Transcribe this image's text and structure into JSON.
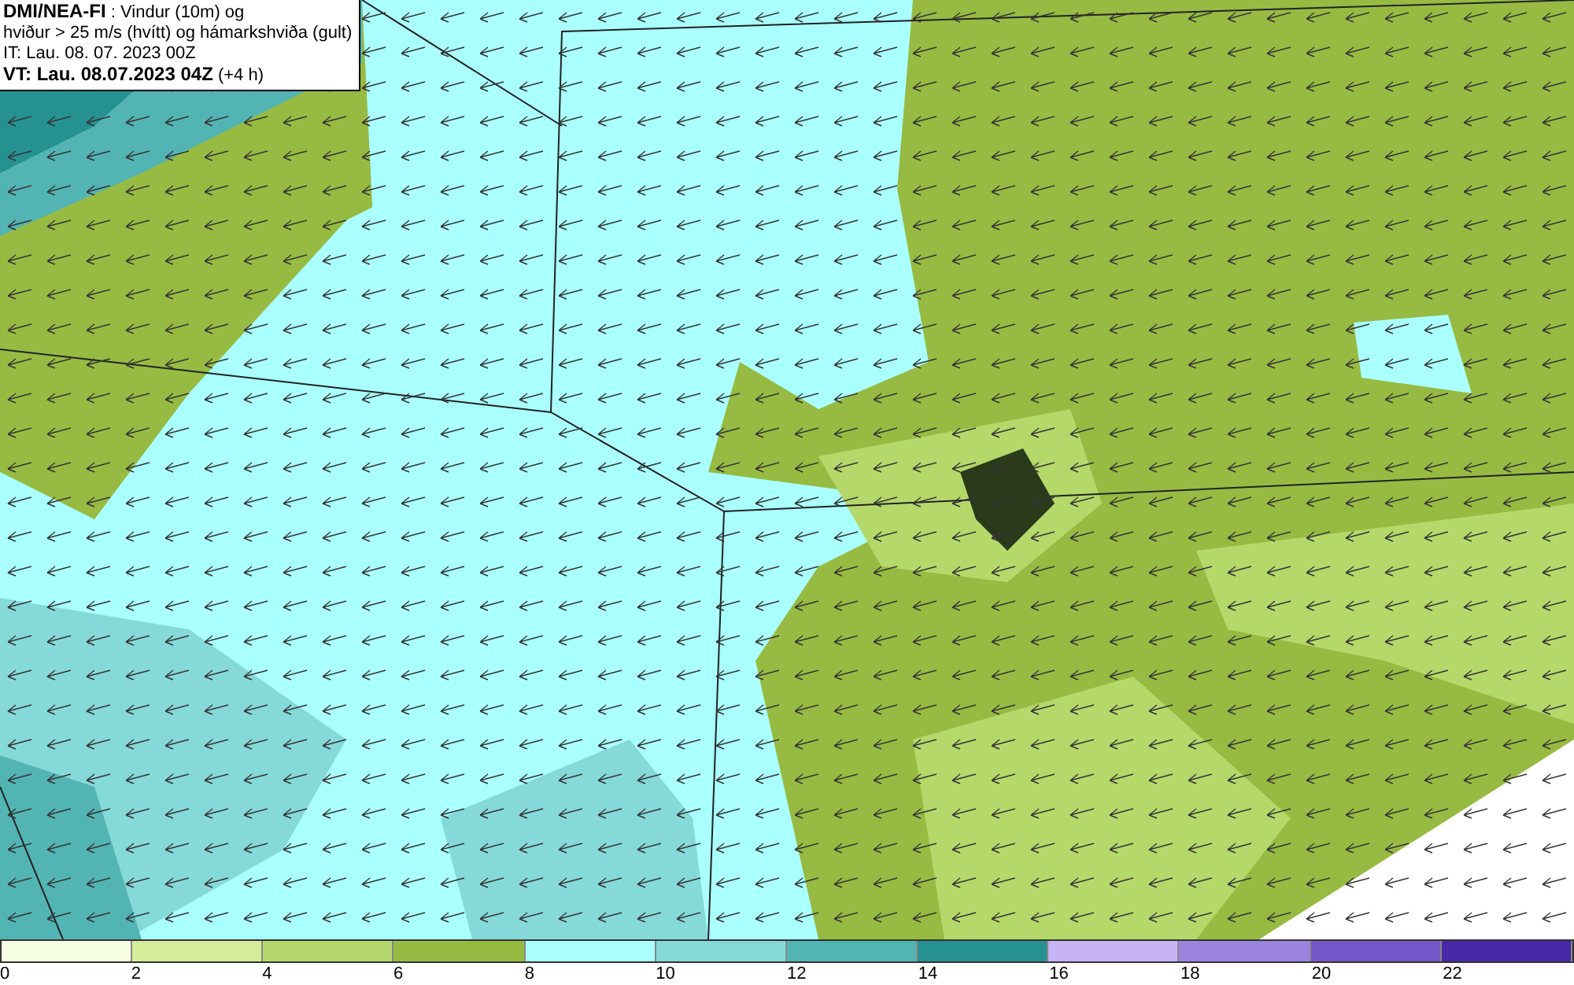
{
  "info_box": {
    "lines": [
      "**DMI/NEA-FI** : Vindur (10m) og",
      "hviður > 25 m/s (hvítt) og hámarkshviða (gult)",
      "IT: Lau. 08. 07. 2023 00Z",
      "**VT: Lau. 08.07.2023 04Z** (+4 h)"
    ]
  },
  "legend": [
    {
      "label": "0",
      "color": "#f5fde2"
    },
    {
      "label": "2",
      "color": "#d5ec98"
    },
    {
      "label": "4",
      "color": "#b5d86c"
    },
    {
      "label": "6",
      "color": "#97bb42"
    },
    {
      "label": "8",
      "color": "#aaffff"
    },
    {
      "label": "10",
      "color": "#86d9d9"
    },
    {
      "label": "12",
      "color": "#53b4b4"
    },
    {
      "label": "14",
      "color": "#259191"
    },
    {
      "label": "16",
      "color": "#c6b4f7"
    },
    {
      "label": "18",
      "color": "#9b85e0"
    },
    {
      "label": "20",
      "color": "#7457c8"
    },
    {
      "label": "22",
      "color": "#4a29a8"
    }
  ]
}
